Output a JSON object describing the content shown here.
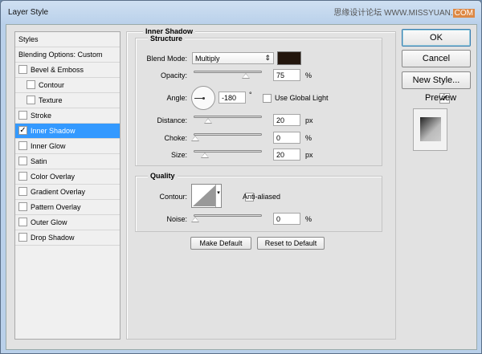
{
  "window": {
    "title": "Layer Style",
    "watermark": "思缘设计论坛 WWW.MISSYUAN.COM"
  },
  "styles_list": {
    "header": "Styles",
    "items": [
      {
        "label": "Blending Options: Custom",
        "checkbox": false,
        "checked": false,
        "indent": false
      },
      {
        "label": "Bevel & Emboss",
        "checkbox": true,
        "checked": false,
        "indent": false
      },
      {
        "label": "Contour",
        "checkbox": true,
        "checked": false,
        "indent": true
      },
      {
        "label": "Texture",
        "checkbox": true,
        "checked": false,
        "indent": true
      },
      {
        "label": "Stroke",
        "checkbox": true,
        "checked": false,
        "indent": false
      },
      {
        "label": "Inner Shadow",
        "checkbox": true,
        "checked": true,
        "indent": false,
        "selected": true
      },
      {
        "label": "Inner Glow",
        "checkbox": true,
        "checked": false,
        "indent": false
      },
      {
        "label": "Satin",
        "checkbox": true,
        "checked": false,
        "indent": false
      },
      {
        "label": "Color Overlay",
        "checkbox": true,
        "checked": false,
        "indent": false
      },
      {
        "label": "Gradient Overlay",
        "checkbox": true,
        "checked": false,
        "indent": false
      },
      {
        "label": "Pattern Overlay",
        "checkbox": true,
        "checked": false,
        "indent": false
      },
      {
        "label": "Outer Glow",
        "checkbox": true,
        "checked": false,
        "indent": false
      },
      {
        "label": "Drop Shadow",
        "checkbox": true,
        "checked": false,
        "indent": false
      }
    ]
  },
  "inner_shadow": {
    "title": "Inner Shadow",
    "structure": {
      "title": "Structure",
      "blend_mode_label": "Blend Mode:",
      "blend_mode": "Multiply",
      "color": "#22150c",
      "opacity_label": "Opacity:",
      "opacity": "75",
      "opacity_unit": "%",
      "angle_label": "Angle:",
      "angle": "-180",
      "angle_unit": "°",
      "global_light_label": "Use Global Light",
      "global_light": false,
      "distance_label": "Distance:",
      "distance": "20",
      "distance_unit": "px",
      "choke_label": "Choke:",
      "choke": "0",
      "choke_unit": "%",
      "size_label": "Size:",
      "size": "20",
      "size_unit": "px"
    },
    "quality": {
      "title": "Quality",
      "contour_label": "Contour:",
      "anti_aliased_label": "Anti-aliased",
      "anti_aliased": false,
      "noise_label": "Noise:",
      "noise": "0",
      "noise_unit": "%"
    },
    "make_default": "Make Default",
    "reset_default": "Reset to Default"
  },
  "buttons": {
    "ok": "OK",
    "cancel": "Cancel",
    "new_style": "New Style...",
    "preview_label": "Preview",
    "preview": true
  }
}
